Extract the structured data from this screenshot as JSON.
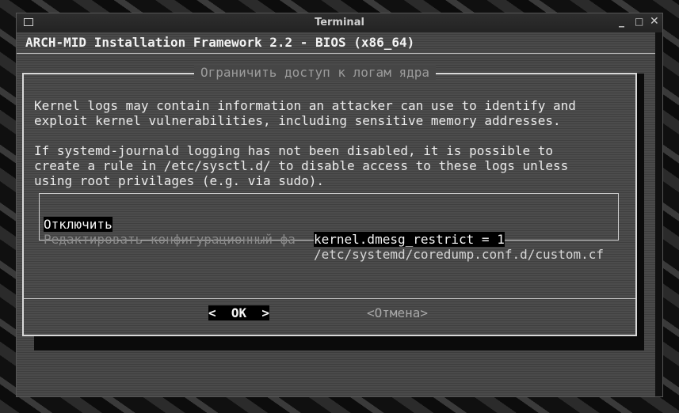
{
  "window": {
    "title": "Terminal",
    "controls": [
      "_",
      "□",
      "✕"
    ]
  },
  "backtitle": "ARCH-MID Installation Framework 2.2 - BIOS (x86_64)",
  "dialog": {
    "title": "Ограничить доступ к логам ядра",
    "message": [
      "Kernel logs may contain information an attacker can use to identify and",
      "exploit kernel vulnerabilities, including sensitive memory addresses.",
      "",
      "If systemd-journald logging has not been disabled, it is possible to",
      "create a rule in /etc/sysctl.d/ to disable access to these logs unless",
      "using root privilages (e.g. via sudo)."
    ],
    "menu": [
      {
        "tag": "Отключить",
        "item": "kernel.dmesg_restrict = 1"
      },
      {
        "tag": "Редактировать конфигурационный фа",
        "item": "/etc/systemd/coredump.conf.d/custom.cf"
      }
    ],
    "buttons": {
      "ok": "<  OK  >",
      "cancel": "<Отмена>"
    }
  }
}
